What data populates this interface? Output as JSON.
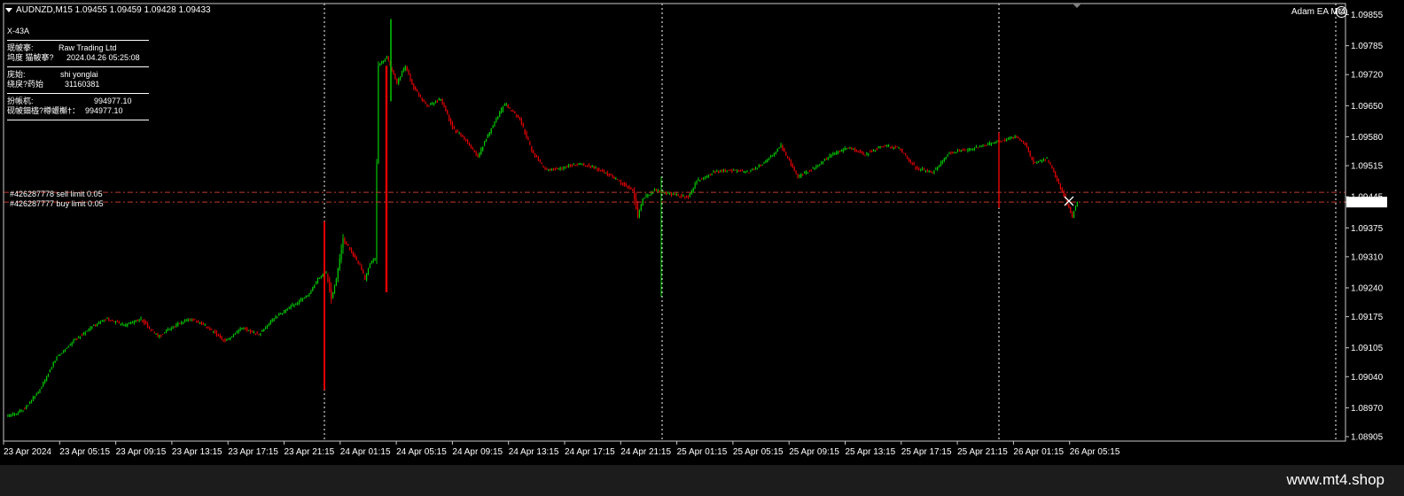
{
  "window": {
    "title": "AUDNZD,M15  1.09455 1.09459 1.09428 1.09433",
    "ea_label": "Adam EA Mt4",
    "smile_icon": "smiley-icon"
  },
  "info_panel": {
    "id": "X-43A",
    "broker_label": "珉帔搴:",
    "broker_value": "Raw Trading Ltd",
    "time_label": "坞度    猫帔搴?",
    "time_value": "2024.04.26 05:25:08",
    "name_label": "庑始:",
    "name_value": "shi yonglai",
    "account_label": "绕戾?药始",
    "account_value": "31160381",
    "balance_label": "扮帳杌:",
    "balance_value": "994977.10",
    "equity_label": "砚帔鈿橀?樽蝘槲†：",
    "equity_value": "994977.10"
  },
  "orders": [
    {
      "label": "#426287778 sell limit 0.05",
      "price": 1.09455
    },
    {
      "label": "#426287777 buy limit 0.05",
      "price": 1.09433
    }
  ],
  "watermark": "www.mt4.shop",
  "chart_data": {
    "type": "candlestick",
    "symbol": "AUDNZD",
    "timeframe": "M15",
    "last_price": "1.09433",
    "ylim": [
      1.08895,
      1.0988
    ],
    "y_ticks": [
      "1.09855",
      "1.09785",
      "1.09720",
      "1.09650",
      "1.09580",
      "1.09515",
      "1.09445",
      "1.09433",
      "1.09375",
      "1.09310",
      "1.09240",
      "1.09175",
      "1.09105",
      "1.09040",
      "1.08970",
      "1.08905"
    ],
    "x_ticks": [
      "23 Apr 2024",
      "23 Apr 05:15",
      "23 Apr 09:15",
      "23 Apr 13:15",
      "23 Apr 17:15",
      "23 Apr 21:15",
      "24 Apr 01:15",
      "24 Apr 05:15",
      "24 Apr 09:15",
      "24 Apr 13:15",
      "24 Apr 17:15",
      "24 Apr 21:15",
      "25 Apr 01:15",
      "25 Apr 05:15",
      "25 Apr 09:15",
      "25 Apr 13:15",
      "25 Apr 17:15",
      "25 Apr 21:15",
      "26 Apr 01:15",
      "26 Apr 05:15"
    ],
    "bull_color": "#00c800",
    "bear_color": "#e00000",
    "path": [
      [
        0,
        1.0895
      ],
      [
        10,
        1.08965
      ],
      [
        20,
        1.0901
      ],
      [
        30,
        1.09085
      ],
      [
        40,
        1.0912
      ],
      [
        50,
        1.0915
      ],
      [
        60,
        1.0917
      ],
      [
        70,
        1.09155
      ],
      [
        80,
        1.0917
      ],
      [
        90,
        1.0913
      ],
      [
        100,
        1.09155
      ],
      [
        110,
        1.0917
      ],
      [
        120,
        1.0915
      ],
      [
        130,
        1.0912
      ],
      [
        140,
        1.0915
      ],
      [
        150,
        1.09135
      ],
      [
        160,
        1.09175
      ],
      [
        170,
        1.092
      ],
      [
        180,
        1.09225
      ],
      [
        185,
        1.0926
      ],
      [
        190,
        1.09275
      ],
      [
        193,
        1.09215
      ],
      [
        196,
        1.0926
      ],
      [
        200,
        1.0935
      ],
      [
        205,
        1.0932
      ],
      [
        210,
        1.0929
      ],
      [
        213,
        1.0926
      ],
      [
        216,
        1.09295
      ],
      [
        219,
        1.09305
      ],
      [
        221,
        1.0974
      ],
      [
        226,
        1.0976
      ],
      [
        232,
        1.097
      ],
      [
        237,
        1.0974
      ],
      [
        242,
        1.0969
      ],
      [
        250,
        1.0965
      ],
      [
        258,
        1.09665
      ],
      [
        265,
        1.096
      ],
      [
        272,
        1.09575
      ],
      [
        280,
        1.09535
      ],
      [
        288,
        1.096
      ],
      [
        296,
        1.09655
      ],
      [
        305,
        1.0962
      ],
      [
        312,
        1.0955
      ],
      [
        320,
        1.09505
      ],
      [
        330,
        1.0951
      ],
      [
        340,
        1.0952
      ],
      [
        350,
        1.0951
      ],
      [
        360,
        1.0949
      ],
      [
        372,
        1.0946
      ],
      [
        375,
        1.094
      ],
      [
        378,
        1.0944
      ],
      [
        385,
        1.0946
      ],
      [
        395,
        1.0945
      ],
      [
        405,
        1.09445
      ],
      [
        410,
        1.0948
      ],
      [
        420,
        1.095
      ],
      [
        430,
        1.09505
      ],
      [
        440,
        1.095
      ],
      [
        450,
        1.0952
      ],
      [
        460,
        1.0956
      ],
      [
        465,
        1.09525
      ],
      [
        470,
        1.0949
      ],
      [
        480,
        1.0951
      ],
      [
        490,
        1.0954
      ],
      [
        500,
        1.09555
      ],
      [
        510,
        1.0954
      ],
      [
        520,
        1.0956
      ],
      [
        530,
        1.09555
      ],
      [
        540,
        1.0951
      ],
      [
        550,
        1.095
      ],
      [
        560,
        1.09545
      ],
      [
        570,
        1.0955
      ],
      [
        580,
        1.0956
      ],
      [
        590,
        1.0957
      ],
      [
        600,
        1.0958
      ],
      [
        605,
        1.09565
      ],
      [
        610,
        1.0952
      ],
      [
        618,
        1.0953
      ],
      [
        625,
        1.09475
      ],
      [
        630,
        1.0943
      ],
      [
        633,
        1.094
      ],
      [
        636,
        1.09435
      ]
    ]
  }
}
